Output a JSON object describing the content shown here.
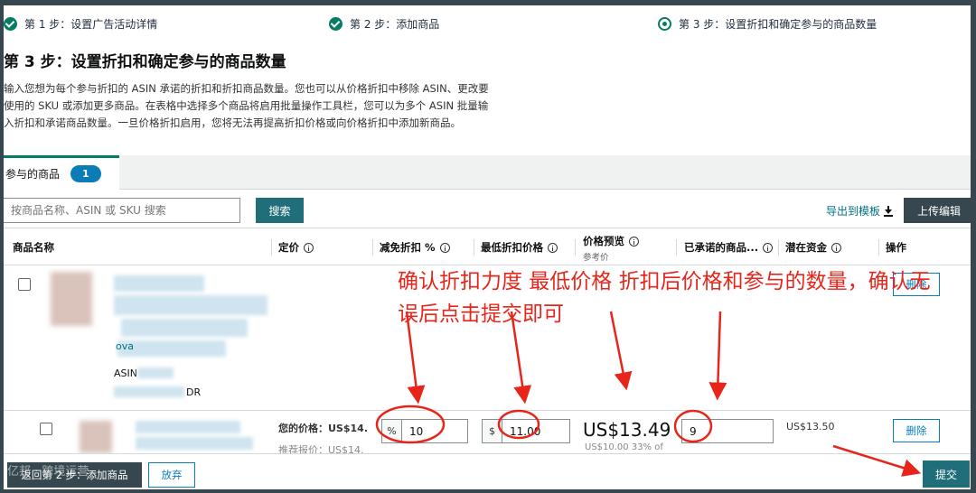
{
  "stepper": {
    "step1": "第 1 步：设置广告活动详情",
    "step2": "第 2 步：添加商品",
    "step3": "第 3 步：设置折扣和确定参与的商品数量"
  },
  "page": {
    "title": "第 3 步：设置折扣和确定参与的商品数量",
    "description": "输入您想为每个参与折扣的 ASIN 承诺的折扣和折扣商品数量。您也可以从价格折扣中移除 ASIN、更改要使用的 SKU 或添加更多商品。在表格中选择多个商品将启用批量操作工具栏，您可以为多个 ASIN 批量输入折扣和承诺商品数量。一旦价格折扣启用，您将无法再提高折扣价格或向价格折扣中添加新商品。"
  },
  "tabs": {
    "participating": {
      "label": "参与的商品",
      "count": "1"
    }
  },
  "toolbar": {
    "search_placeholder": "按商品名称、ASIN 或 SKU 搜索",
    "search_label": "搜索",
    "export_label": "导出到模板",
    "upload_label": "上传编辑"
  },
  "table": {
    "headers": {
      "name": "商品名称",
      "price": "定价",
      "discount": "减免折扣 %",
      "min_price": "最低折扣价格",
      "preview": "价格预览",
      "preview_sub": "参考价",
      "committed": "已承诺的商品...",
      "potential": "潜在资金",
      "actions": "操作"
    },
    "rows": [
      {
        "asin_label": "ASIN",
        "sku_suffix": "DR",
        "link_fragment": "ova"
      },
      {
        "your_price": "您的价格：US$14.",
        "list_price": "推荐报价：US$14.",
        "discount_prefix": "%",
        "discount_value": "10",
        "min_price_prefix": "$",
        "min_price_value": "11.00",
        "preview_price": "US$13.49",
        "preview_sub": "US$10.00 33% of",
        "committed_value": "9",
        "potential": "US$13.50",
        "delete_label": "删除"
      }
    ],
    "row1_delete_label": "删除"
  },
  "footer": {
    "back_label": "返回第 2 步：添加商品",
    "cancel_label": "放弃",
    "submit_label": "提交"
  },
  "annotation": {
    "text": "确认折扣力度  最低价格  折扣后价格和参与的数量，确认无误后点击提交即可",
    "color": "#e8251b"
  },
  "watermark": "亿邦 · 跨境运营",
  "colors": {
    "accent": "#067d62",
    "button_dark": "#1f6e7a",
    "link": "#007185",
    "badge": "#0b7cb8",
    "annotation": "#e8251b"
  }
}
